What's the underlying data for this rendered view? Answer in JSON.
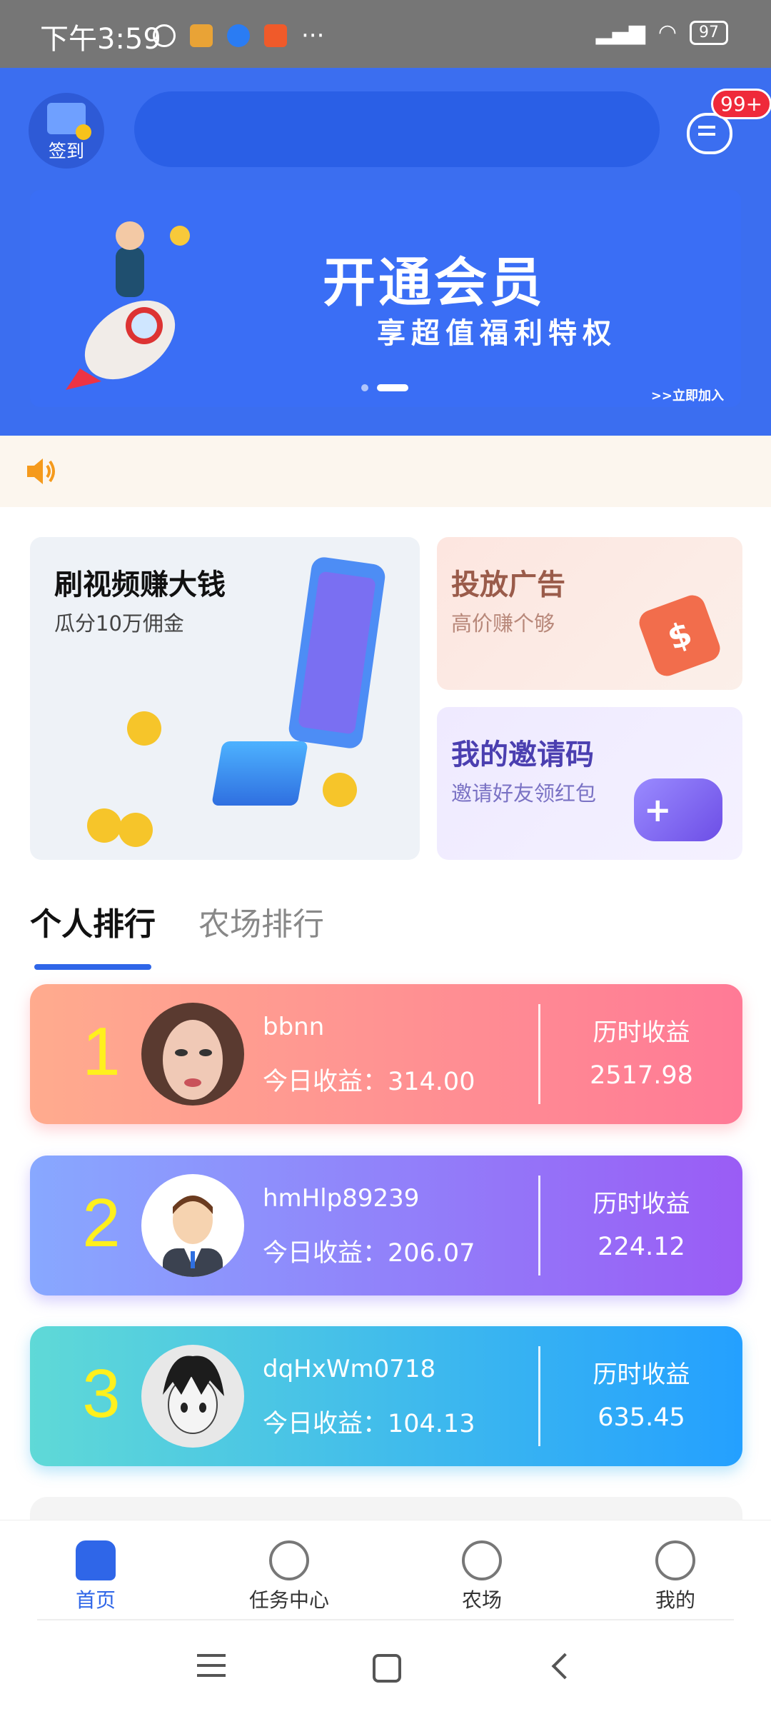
{
  "status_bar": {
    "time": "下午3:59",
    "battery": "97"
  },
  "header": {
    "sign_in_label": "签到",
    "message_badge": "99+"
  },
  "banner": {
    "title": "开通会员",
    "subtitle": "享超值福利特权",
    "join_link": ">>立即加入"
  },
  "cards": {
    "video": {
      "title": "刷视频赚大钱",
      "subtitle": "瓜分10万佣金"
    },
    "ad": {
      "title": "投放广告",
      "subtitle": "高价赚个够"
    },
    "invite": {
      "title": "我的邀请码",
      "subtitle": "邀请好友领红包"
    }
  },
  "ranking_tabs": [
    "个人排行",
    "农场排行"
  ],
  "ranking": [
    {
      "rank": "1",
      "name": "bbnn",
      "today": "今日收益：314.00",
      "hist_label": "历时收益",
      "hist_value": "2517.98"
    },
    {
      "rank": "2",
      "name": "hmHlp89239",
      "today": "今日收益：206.07",
      "hist_label": "历时收益",
      "hist_value": "224.12"
    },
    {
      "rank": "3",
      "name": "dqHxWm0718",
      "today": "今日收益：104.13",
      "hist_label": "历时收益",
      "hist_value": "635.45"
    }
  ],
  "tabbar": [
    {
      "label": "首页",
      "icon": "home-icon",
      "active": true
    },
    {
      "label": "任务中心",
      "icon": "task-icon",
      "active": false
    },
    {
      "label": "农场",
      "icon": "farm-icon",
      "active": false
    },
    {
      "label": "我的",
      "icon": "profile-icon",
      "active": false
    }
  ],
  "colors": {
    "primary": "#3b6ef0",
    "rank_number": "#fff01d"
  }
}
